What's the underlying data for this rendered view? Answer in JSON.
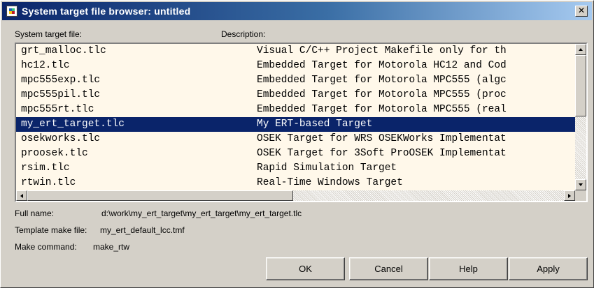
{
  "window": {
    "title": "System target file browser: untitled",
    "close_glyph": "✕"
  },
  "headers": {
    "file": "System target file:",
    "description": "Description:"
  },
  "rows": [
    {
      "file": "grt_malloc.tlc",
      "description": "Visual C/C++ Project Makefile only for th"
    },
    {
      "file": "hc12.tlc",
      "description": "Embedded Target for Motorola HC12 and Cod"
    },
    {
      "file": "mpc555exp.tlc",
      "description": "Embedded Target for Motorola MPC555 (algc"
    },
    {
      "file": "mpc555pil.tlc",
      "description": "Embedded Target for Motorola MPC555 (proc"
    },
    {
      "file": "mpc555rt.tlc",
      "description": "Embedded Target for Motorola MPC555 (real"
    },
    {
      "file": "my_ert_target.tlc",
      "description": "My ERT-based Target"
    },
    {
      "file": "osekworks.tlc",
      "description": "OSEK Target for WRS OSEKWorks Implementat"
    },
    {
      "file": "proosek.tlc",
      "description": "OSEK Target for 3Soft ProOSEK Implementat"
    },
    {
      "file": "rsim.tlc",
      "description": "Rapid Simulation Target"
    },
    {
      "file": "rtwin.tlc",
      "description": "Real-Time Windows Target"
    }
  ],
  "selected_index": 5,
  "details": {
    "full_name_label": "Full name:",
    "full_name_value": "d:\\work\\my_ert_target\\my_ert_target\\my_ert_target.tlc",
    "template_label": "Template make file:",
    "template_value": "my_ert_default_lcc.tmf",
    "make_label": "Make command:",
    "make_value": "make_rtw"
  },
  "buttons": {
    "ok": "OK",
    "cancel": "Cancel",
    "help": "Help",
    "apply": "Apply"
  },
  "colors": {
    "selection": "#0a246a",
    "list_background": "#fff8ea",
    "dialog_background": "#d4d0c8"
  },
  "icons": {
    "app": "matlab-window-icon",
    "close": "close-icon"
  }
}
